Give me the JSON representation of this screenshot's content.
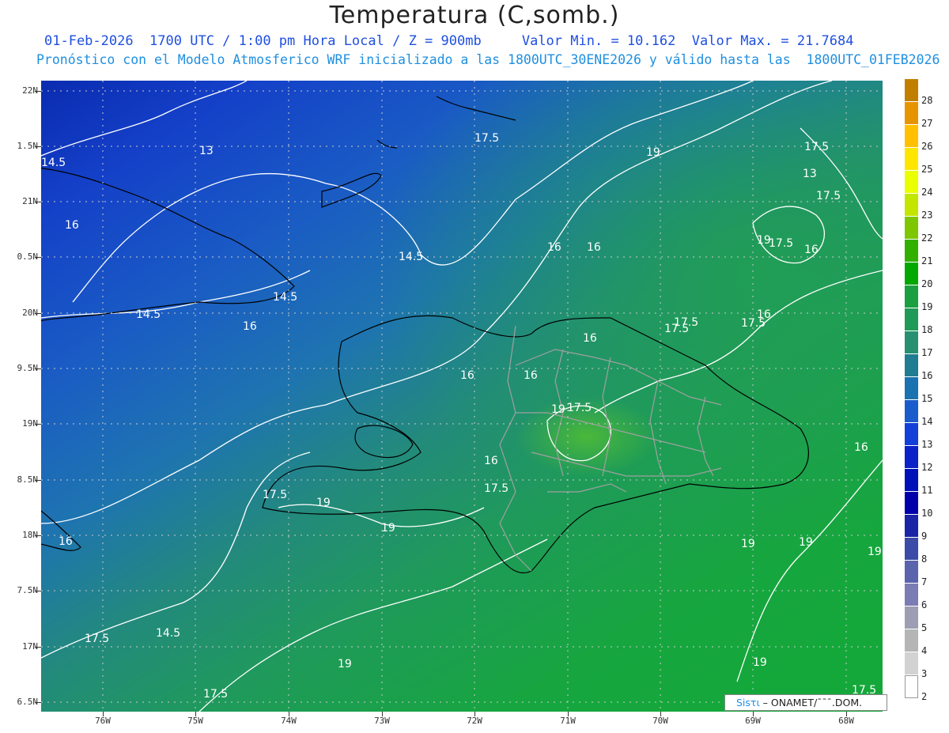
{
  "header": {
    "title": "Temperatura (C,somb.)",
    "line1": "01-Feb-2026  1700 UTC / 1:00 pm Hora Local / Z = 900mb     Valor Min. = 10.162  Valor Max. = 21.7684",
    "line2": "Pronóstico con el Modelo Atmosferico WRF inicializado a las 1800UTC_30ENE2026 y válido hasta las  1800UTC_01FEB2026"
  },
  "axes": {
    "lat_labels": [
      "22N",
      "1.5N",
      "21N",
      "0.5N",
      "20N",
      "9.5N",
      "19N",
      "8.5N",
      "18N",
      "7.5N",
      "17N",
      "6.5N"
    ],
    "lon_labels": [
      "76W",
      "75W",
      "74W",
      "73W",
      "72W",
      "71W",
      "70W",
      "69W",
      "68W"
    ]
  },
  "contour_labels": [
    "14.5",
    "13",
    "16",
    "17.5",
    "19",
    "14.5",
    "16",
    "13",
    "14.5",
    "14.5",
    "16",
    "17.5",
    "17.5",
    "16",
    "16",
    "16",
    "17.5",
    "19",
    "16",
    "17.5",
    "17.5",
    "19",
    "19",
    "19",
    "19",
    "16",
    "16",
    "17.5",
    "14.5",
    "17.5",
    "19",
    "19",
    "17.5",
    "16",
    "19",
    "16",
    "16",
    "17.5",
    "17.5",
    "17.5",
    "17.5",
    "19"
  ],
  "colorbar": {
    "levels": [
      "28",
      "27",
      "26",
      "25",
      "24",
      "23",
      "22",
      "21",
      "20",
      "19",
      "18",
      "17",
      "16",
      "15",
      "14",
      "13",
      "12",
      "11",
      "10",
      "9",
      "8",
      "7",
      "6",
      "5",
      "4",
      "3",
      "2"
    ],
    "colors": [
      "#c17f00",
      "#e69500",
      "#ffc000",
      "#ffe600",
      "#eaff00",
      "#c3e600",
      "#7dc600",
      "#32b000",
      "#00a800",
      "#1aa040",
      "#209a58",
      "#269070",
      "#207c90",
      "#1a72b0",
      "#1a5ccc",
      "#1240d8",
      "#0a22c8",
      "#0010b8",
      "#0000aa",
      "#1a24a6",
      "#3c4aa8",
      "#5a64ad",
      "#7a7cb3",
      "#9d9db3",
      "#b5b5b5",
      "#d2d2d2",
      "#ffffff"
    ]
  },
  "credit": {
    "sistema": "Sisτι",
    "org": "– ONAMET/¯¯¯.DOM."
  }
}
